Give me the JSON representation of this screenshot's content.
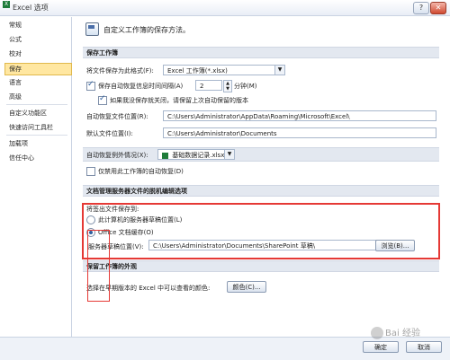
{
  "window": {
    "title": "Excel 选项",
    "help": "?",
    "close": "✕"
  },
  "sidebar": {
    "items": [
      {
        "label": "常规"
      },
      {
        "label": "公式"
      },
      {
        "label": "校对"
      },
      {
        "label": "保存",
        "selected": true
      },
      {
        "label": "语言"
      },
      {
        "label": "高级"
      },
      {
        "label": "自定义功能区"
      },
      {
        "label": "快速访问工具栏"
      },
      {
        "label": "加载项"
      },
      {
        "label": "信任中心"
      }
    ]
  },
  "header": {
    "text": "自定义工作簿的保存方法。"
  },
  "save_workbooks": {
    "title": "保存工作簿",
    "format_label": "将文件保存为此格式(F):",
    "format_value": "Excel 工作簿(*.xlsx)",
    "autorecover_label": "保存自动恢复信息时间间隔(A)",
    "autorecover_checked": true,
    "autorecover_minutes": "2",
    "minutes_label": "分钟(M)",
    "keep_last_label": "如果我没保存就关闭，请保留上次自动保留的版本",
    "keep_last_checked": true,
    "autorecover_location_label": "自动恢复文件位置(R):",
    "autorecover_location_value": "C:\\Users\\Administrator\\AppData\\Roaming\\Microsoft\\Excel\\",
    "default_location_label": "默认文件位置(I):",
    "default_location_value": "C:\\Users\\Administrator\\Documents"
  },
  "autorecover_exceptions": {
    "label": "自动恢复例外情况(X):",
    "workbook_value": "基础数据记录.xlsx",
    "disable_label": "仅禁用此工作簿的自动恢复(D)",
    "disable_checked": false
  },
  "offline_editing": {
    "title": "文档管理服务器文件的脱机编辑选项",
    "save_to_label": "将签出文件保存到:",
    "option_server_drafts": "此计算机的服务器草稿位置(L)",
    "option_office_cache": "Office 文档缓存(O)",
    "server_drafts_label": "服务器草稿位置(V):",
    "server_drafts_value": "C:\\Users\\Administrator\\Documents\\SharePoint 草稿\\",
    "browse_label": "浏览(B)..."
  },
  "preserve_visual": {
    "title": "保留工作簿的外观",
    "colors_label": "选择在早期版本的 Excel 中可以查看的颜色:",
    "colors_button": "颜色(C)..."
  },
  "footer": {
    "ok_label": "确定",
    "cancel_label": "取消"
  },
  "watermark": "Bai 经验"
}
